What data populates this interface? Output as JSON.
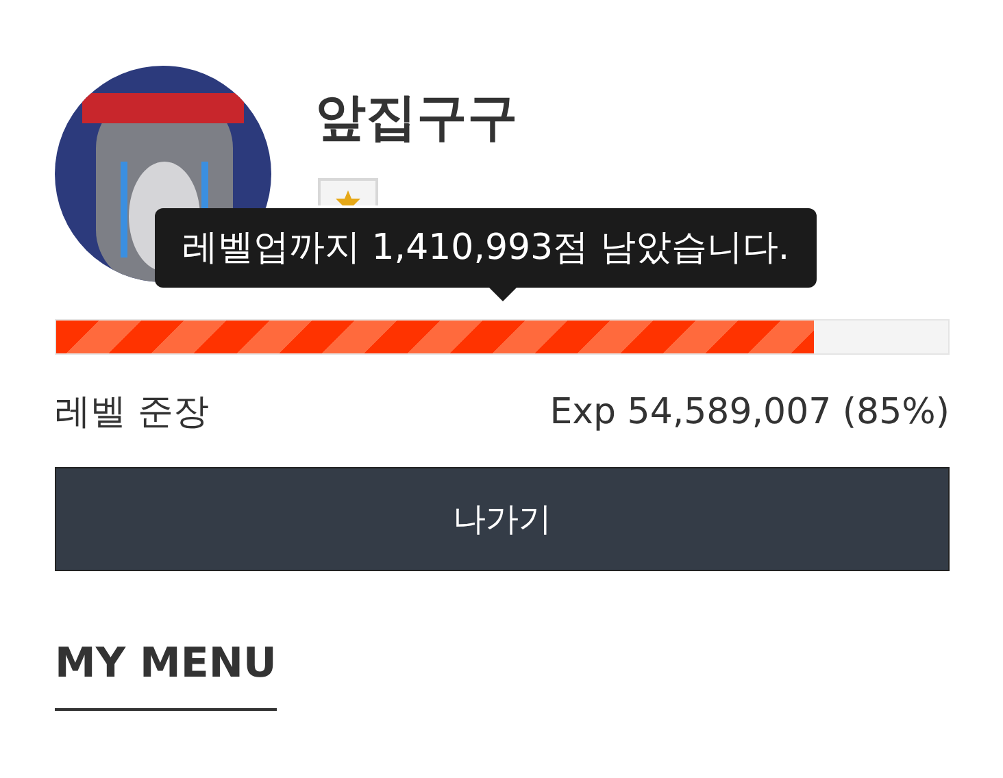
{
  "profile": {
    "name": "앞집구구"
  },
  "tooltip": {
    "text": "레벨업까지 1,410,993점 남았습니다."
  },
  "progress": {
    "level": 0.85
  },
  "level_label": "레벨 준장",
  "exp_label": "Exp 54,589,007 (85%)",
  "logout_button": "나가기",
  "menu_heading": "MY MENU"
}
